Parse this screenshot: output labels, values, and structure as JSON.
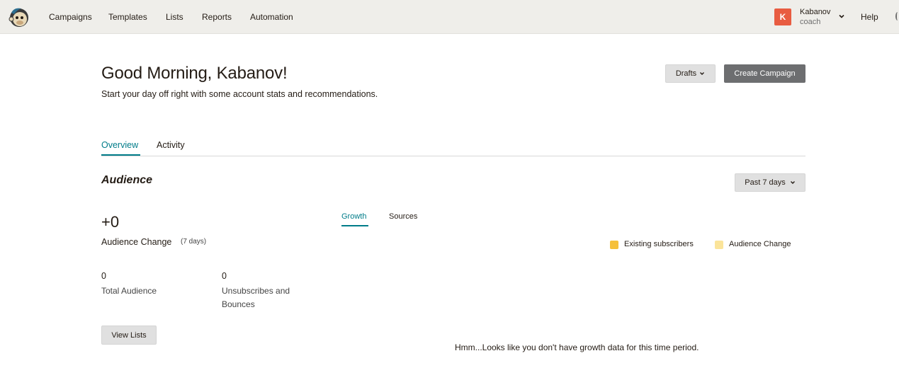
{
  "nav": {
    "items": [
      "Campaigns",
      "Templates",
      "Lists",
      "Reports",
      "Automation"
    ],
    "user": {
      "initial": "K",
      "name": "Kabanov",
      "role": "coach"
    },
    "help": "Help"
  },
  "header": {
    "greeting": "Good Morning, Kabanov!",
    "subtitle": "Start your day off right with some account stats and recommendations.",
    "drafts_label": "Drafts",
    "create_label": "Create Campaign"
  },
  "tabs": [
    {
      "label": "Overview",
      "active": true
    },
    {
      "label": "Activity",
      "active": false
    }
  ],
  "audience": {
    "title": "Audience",
    "period_label": "Past 7 days",
    "change_value": "+0",
    "change_label": "Audience Change",
    "change_period": "(7 days)",
    "total_value": "0",
    "total_label": "Total Audience",
    "unsub_value": "0",
    "unsub_label_line1": "Unsubscribes and",
    "unsub_label_line2": "Bounces",
    "view_lists_label": "View Lists"
  },
  "chart": {
    "tabs": [
      {
        "label": "Growth",
        "active": true
      },
      {
        "label": "Sources",
        "active": false
      }
    ],
    "legend": [
      {
        "label": "Existing subscribers",
        "color": "#f5c03b"
      },
      {
        "label": "Audience Change",
        "color": "#fbe49a"
      }
    ],
    "empty_message": "Hmm...Looks like you don't have growth data for this time period."
  },
  "colors": {
    "accent": "#007c89",
    "avatar": "#e85c41",
    "primary_button": "#6d6e70"
  }
}
